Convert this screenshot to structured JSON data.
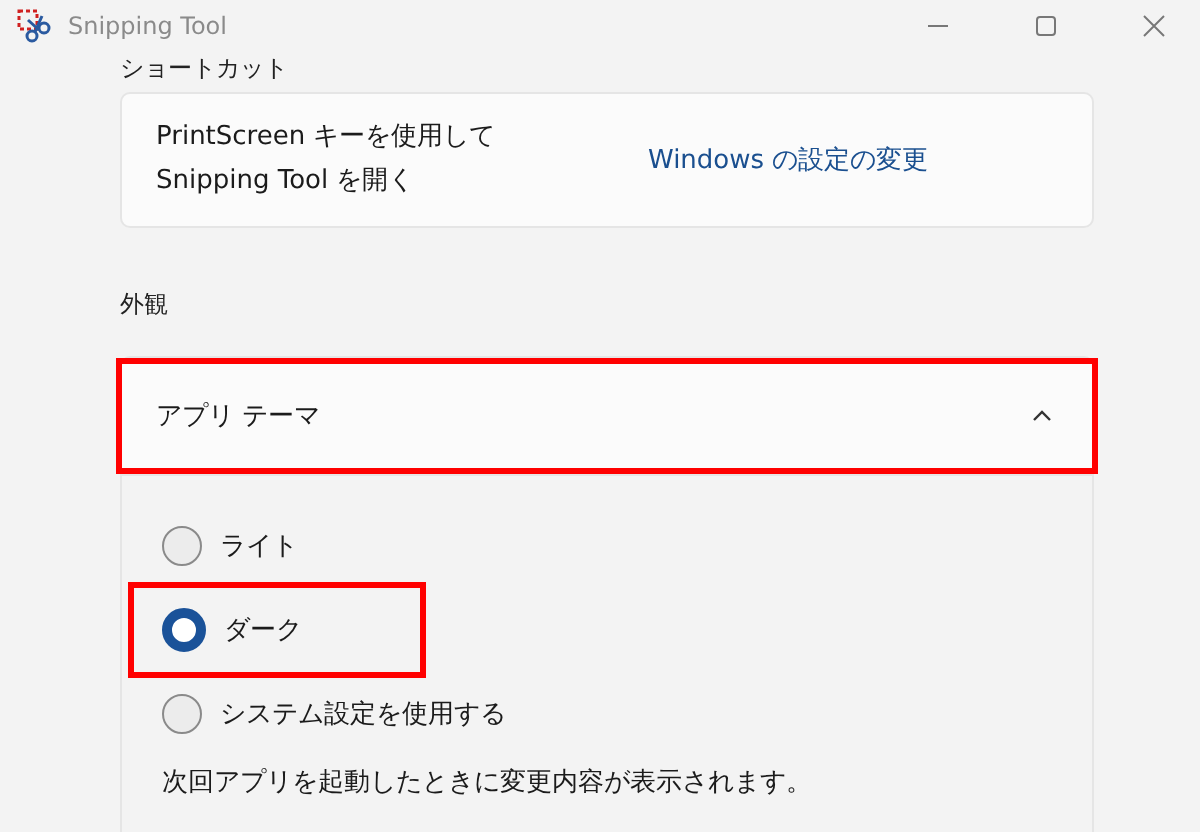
{
  "window": {
    "title": "Snipping Tool"
  },
  "shortcut_section": {
    "heading": "ショートカット",
    "description_lines": [
      "PrintScreen キーを使用して",
      "Snipping Tool を開く"
    ],
    "link": "Windows の設定の変更"
  },
  "appearance_section": {
    "heading": "外観",
    "expander": {
      "label": "アプリ テーマ",
      "expanded": true,
      "highlighted": true
    },
    "options": [
      {
        "label": "ライト",
        "selected": false,
        "highlighted": false
      },
      {
        "label": "ダーク",
        "selected": true,
        "highlighted": true
      },
      {
        "label": "システム設定を使用する",
        "selected": false,
        "highlighted": false
      }
    ],
    "note": "次回アプリを起動したときに変更内容が表示されます。"
  }
}
